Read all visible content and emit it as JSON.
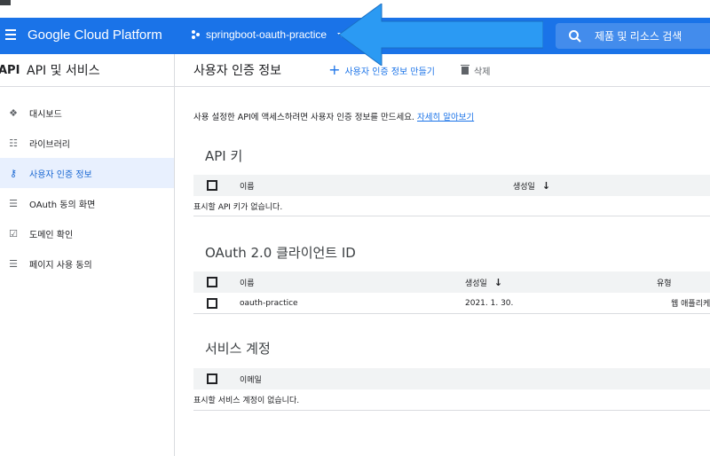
{
  "topbar": {
    "brand": "Google Cloud Platform",
    "project": "springboot-oauth-practice",
    "search_placeholder": "제품 및 리소스 검색"
  },
  "sidebar": {
    "section_badge": "API",
    "section_title": "API 및 서비스",
    "items": [
      {
        "label": "대시보드",
        "icon": "dashboard-icon"
      },
      {
        "label": "라이브러리",
        "icon": "library-icon"
      },
      {
        "label": "사용자 인증 정보",
        "icon": "key-icon",
        "active": true
      },
      {
        "label": "OAuth 동의 화면",
        "icon": "consent-icon"
      },
      {
        "label": "도메인 확인",
        "icon": "domain-check-icon"
      },
      {
        "label": "페이지 사용 동의",
        "icon": "page-consent-icon"
      }
    ]
  },
  "header": {
    "title": "사용자 인증 정보",
    "create_label": "사용자 인증 정보 만들기",
    "delete_label": "삭제"
  },
  "intro": {
    "text": "사용 설정한 API에 액세스하려면 사용자 인증 정보를 만드세요.",
    "link": "자세히 알아보기"
  },
  "api_keys": {
    "title": "API 키",
    "col_name": "이름",
    "col_created": "생성일",
    "empty": "표시할 API 키가 없습니다."
  },
  "oauth": {
    "title": "OAuth 2.0 클라이언트 ID",
    "col_name": "이름",
    "col_created": "생성일",
    "col_type": "유형",
    "rows": [
      {
        "name": "oauth-practice",
        "created": "2021. 1. 30.",
        "type": "웹 애플리케"
      }
    ]
  },
  "service_accounts": {
    "title": "서비스 계정",
    "col_email": "이메일",
    "empty": "표시할 서비스 계정이 없습니다."
  },
  "colors": {
    "brand_blue": "#1a73e8",
    "active_bg": "#e8f0fe",
    "arrow_blue": "#2b9af3"
  }
}
